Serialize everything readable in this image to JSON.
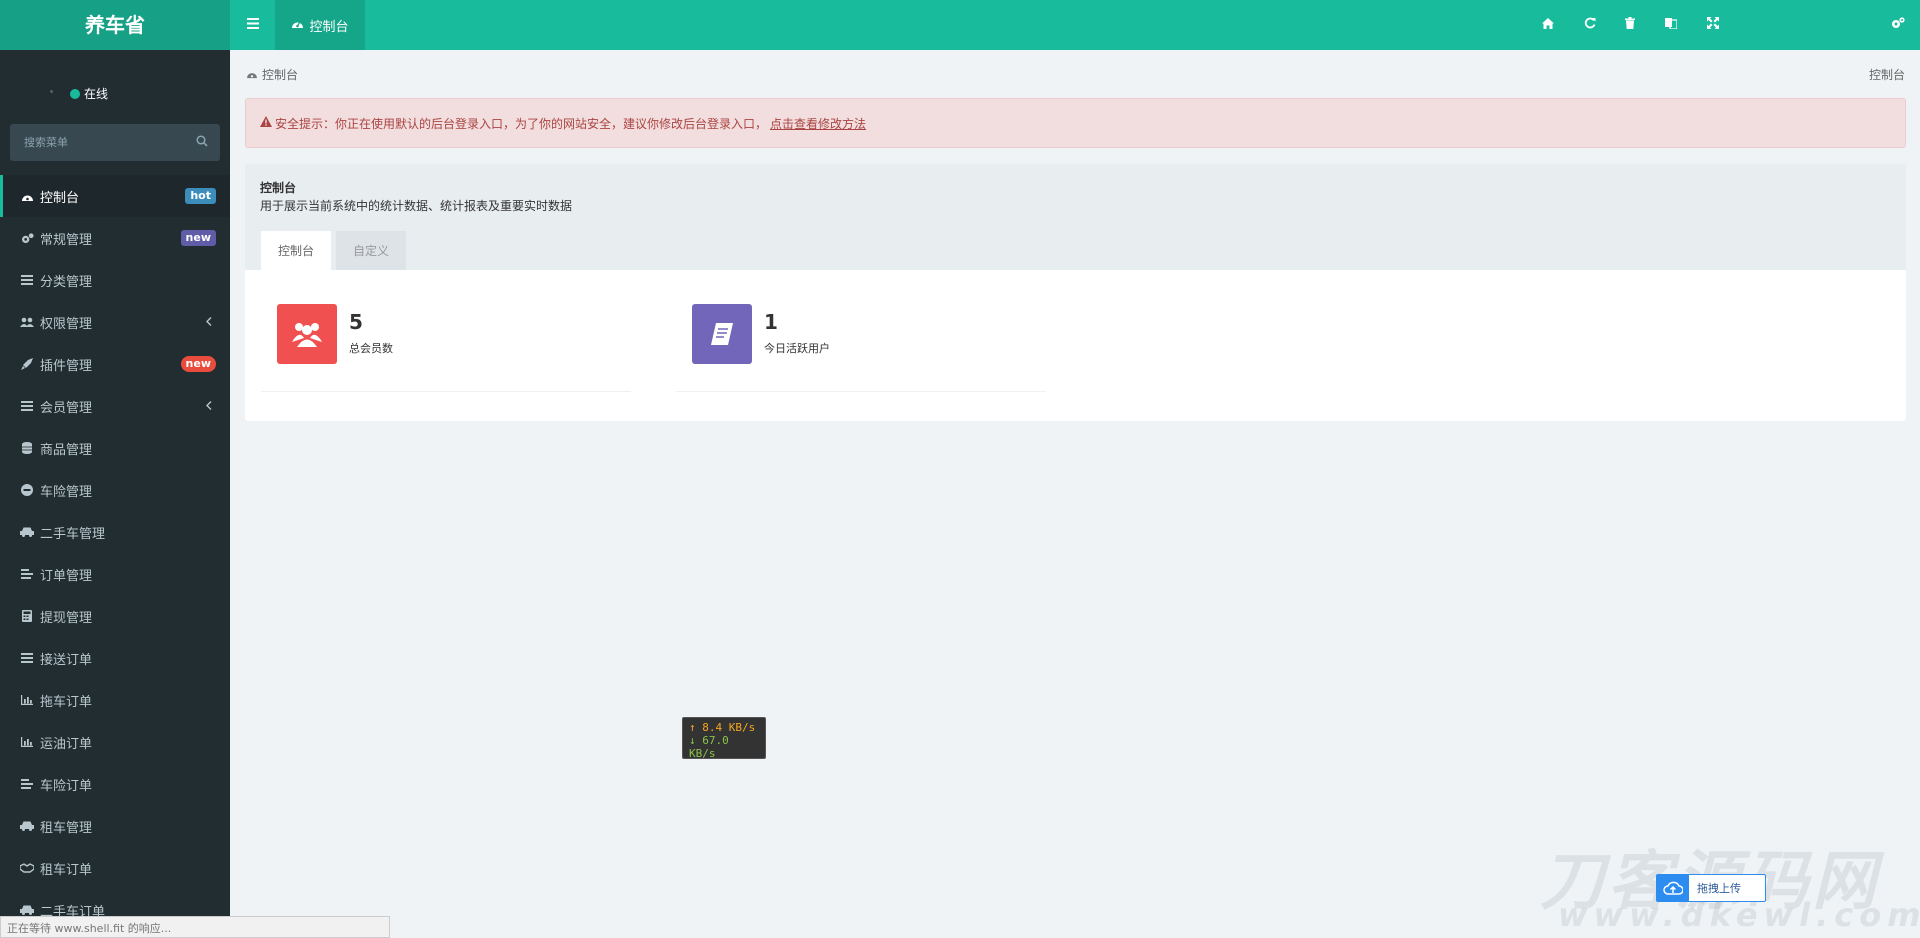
{
  "header": {
    "logo": "养车省",
    "tab_label": "控制台"
  },
  "sidebar": {
    "status": "在线",
    "search_placeholder": "搜索菜单",
    "items": [
      {
        "label": "控制台",
        "badge": "hot"
      },
      {
        "label": "常规管理",
        "badge": "new"
      },
      {
        "label": "分类管理"
      },
      {
        "label": "权限管理"
      },
      {
        "label": "插件管理",
        "badge": "new"
      },
      {
        "label": "会员管理"
      },
      {
        "label": "商品管理"
      },
      {
        "label": "车险管理"
      },
      {
        "label": "二手车管理"
      },
      {
        "label": "订单管理"
      },
      {
        "label": "提现管理"
      },
      {
        "label": "接送订单"
      },
      {
        "label": "拖车订单"
      },
      {
        "label": "运油订单"
      },
      {
        "label": "车险订单"
      },
      {
        "label": "租车管理"
      },
      {
        "label": "租车订单"
      },
      {
        "label": "二手车订单"
      }
    ]
  },
  "content": {
    "breadcrumb": "控制台",
    "breadcrumb_right": "控制台",
    "alert": {
      "text": "安全提示：你正在使用默认的后台登录入口，为了你的网站安全，建议你修改后台登录入口，",
      "link": "点击查看修改方法"
    },
    "panel": {
      "title": "控制台",
      "description": "用于展示当前系统中的统计数据、统计报表及重要实时数据",
      "tabs": [
        "控制台",
        "自定义"
      ]
    },
    "stats": [
      {
        "value": "5",
        "label": "总会员数",
        "color": "#f05050"
      },
      {
        "value": "1",
        "label": "今日活跃用户",
        "color": "#7266ba"
      }
    ]
  },
  "overlay": {
    "speed_up": "↑ 8.4 KB/s",
    "speed_down": "↓ 67.0 KB/s",
    "upload_label": "拖拽上传",
    "watermark_cn": "刀客源码网",
    "watermark_url": "www.dkewl.com",
    "status_bar": "正在等待 www.shell.fit 的响应..."
  },
  "colors": {
    "accent": "#18bc9c",
    "sidebar_bg": "#222d32",
    "danger_icon": "#f05050",
    "purple_icon": "#7266ba"
  }
}
